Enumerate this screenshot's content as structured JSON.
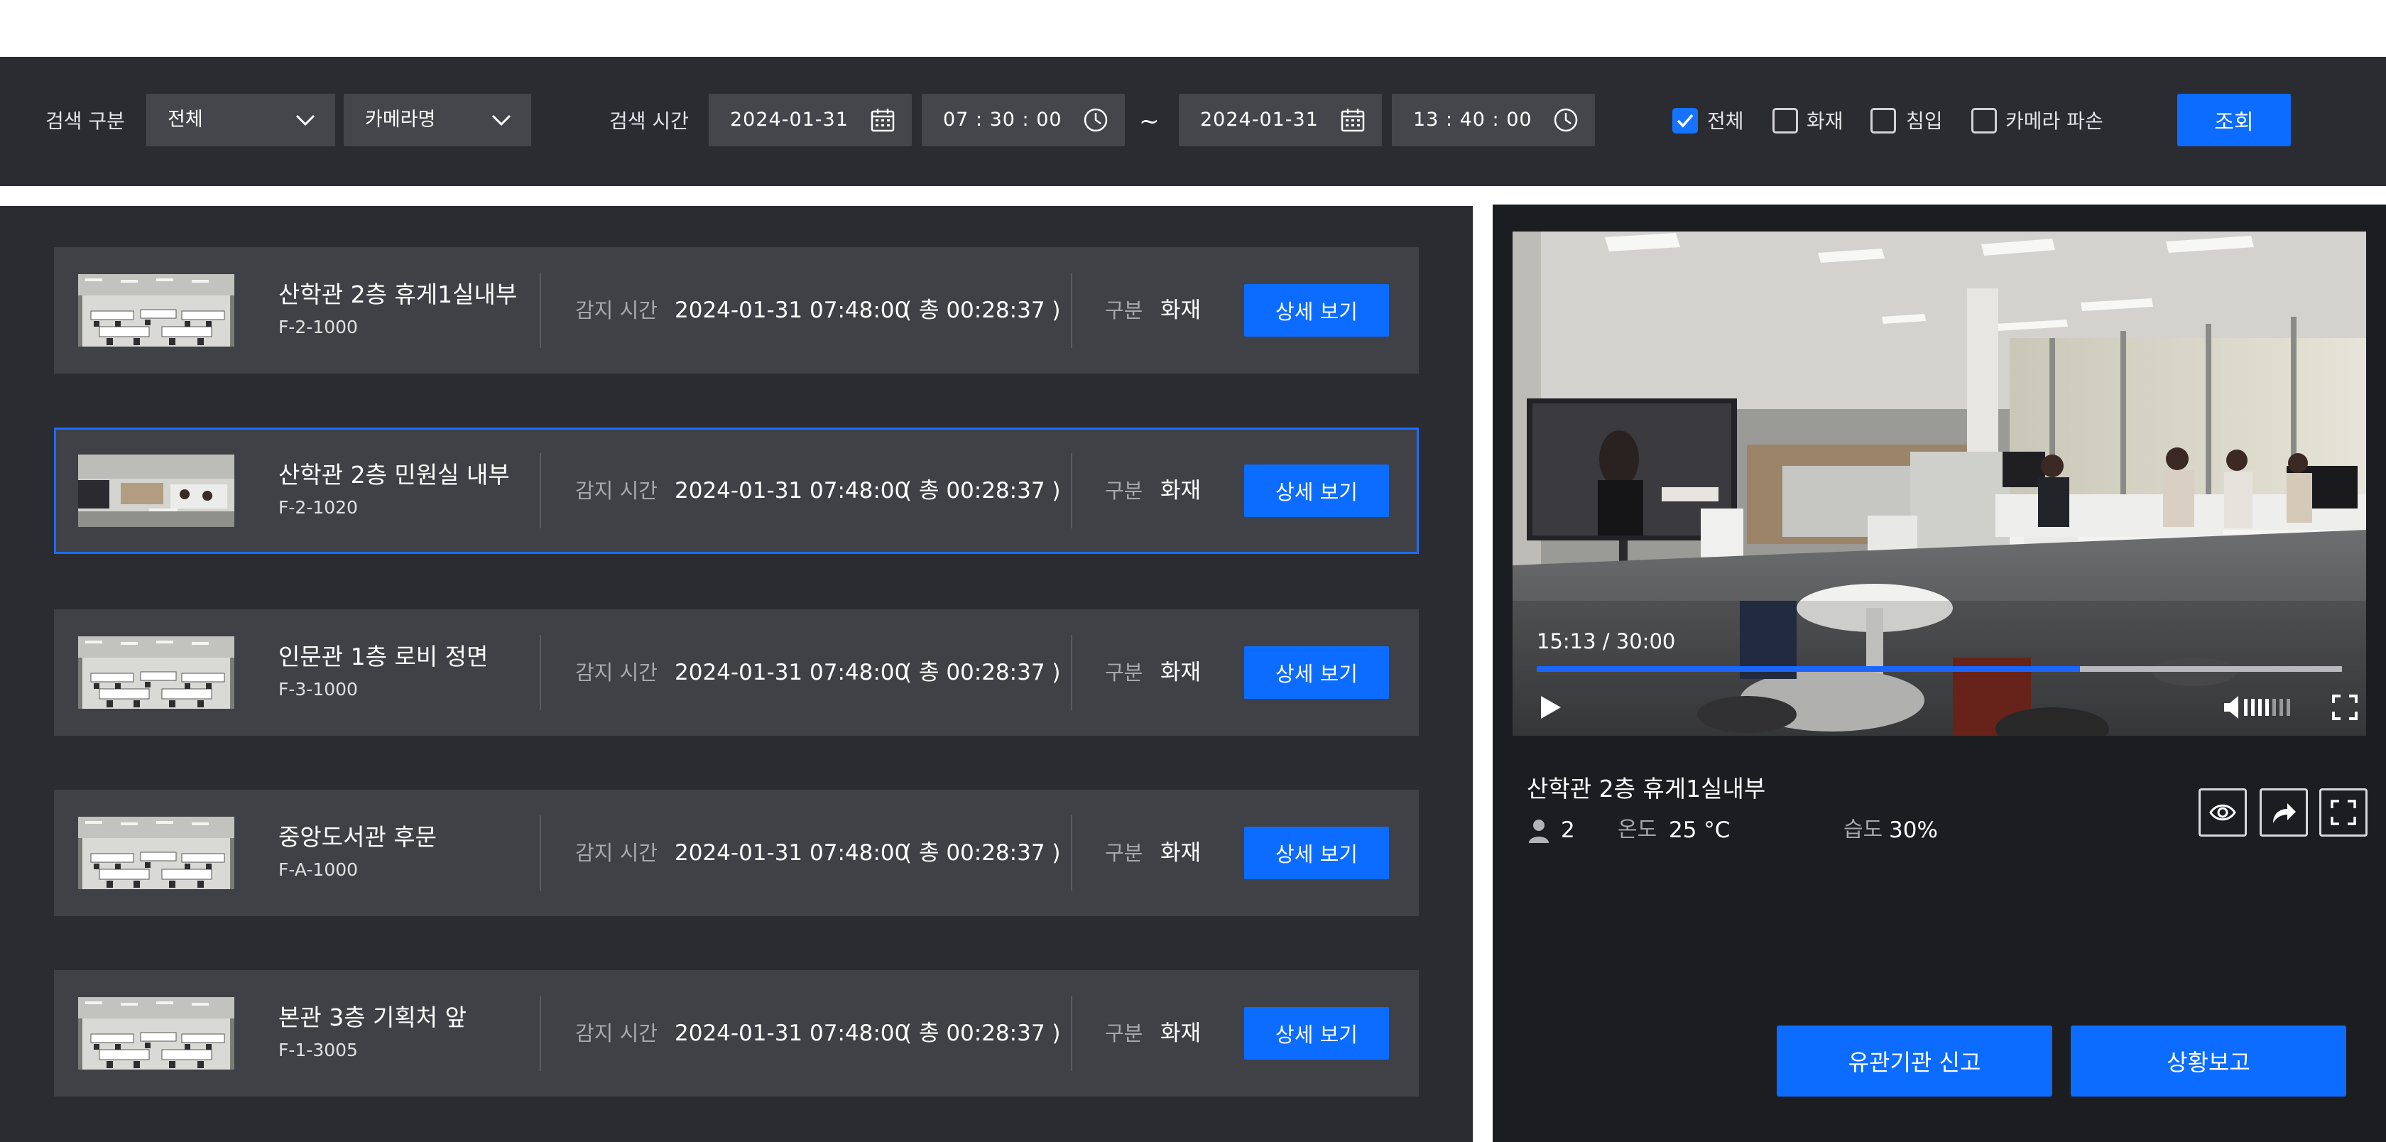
{
  "filter": {
    "search_type_label": "검색 구분",
    "type_select": "전체",
    "camera_select": "카메라명",
    "search_time_label": "검색 시간",
    "start_date": "2024-01-31",
    "start_time": "07 : 30 : 00",
    "range_sep": "~",
    "end_date": "2024-01-31",
    "end_time": "13 : 40 : 00",
    "checks": [
      {
        "label": "전체",
        "checked": true
      },
      {
        "label": "화재",
        "checked": false
      },
      {
        "label": "침입",
        "checked": false
      },
      {
        "label": "카메라 파손",
        "checked": false
      }
    ],
    "search_button": "조회"
  },
  "list": {
    "detect_label": "감지 시간",
    "category_label": "구분",
    "detail_button": "상세 보기",
    "rows": [
      {
        "title": "산학관 2층 휴게1실내부",
        "code": "F-2-1000",
        "datetime": "2024-01-31  07:48:00",
        "total": "( 총 00:28:37 )",
        "category": "화재",
        "selected": false
      },
      {
        "title": "산학관 2층 민원실 내부",
        "code": "F-2-1020",
        "datetime": "2024-01-31  07:48:00",
        "total": "( 총 00:28:37 )",
        "category": "화재",
        "selected": true
      },
      {
        "title": "인문관 1층 로비 정면",
        "code": "F-3-1000",
        "datetime": "2024-01-31  07:48:00",
        "total": "( 총 00:28:37 )",
        "category": "화재",
        "selected": false
      },
      {
        "title": "중앙도서관 후문",
        "code": "F-A-1000",
        "datetime": "2024-01-31  07:48:00",
        "total": "( 총 00:28:37 )",
        "category": "화재",
        "selected": false
      },
      {
        "title": "본관 3층 기획처 앞",
        "code": "F-1-3005",
        "datetime": "2024-01-31  07:48:00",
        "total": "( 총 00:28:37 )",
        "category": "화재",
        "selected": false
      }
    ]
  },
  "player": {
    "time": "15:13  /  30:00",
    "progress": 0.675
  },
  "camera": {
    "name": "산학관 2층 휴게1실내부",
    "people_count": "2",
    "temp_label": "온도",
    "temp_value": "25 °C",
    "humidity_label": "습도",
    "humidity_value": "30%"
  },
  "actions": {
    "report_agency": "유관기관 신고",
    "situation_report": "상황보고"
  },
  "colors": {
    "accent": "#0b6cff",
    "panel_bg": "#2b2c31",
    "row_bg": "#404146",
    "video_panel_bg": "#1c1d21"
  }
}
